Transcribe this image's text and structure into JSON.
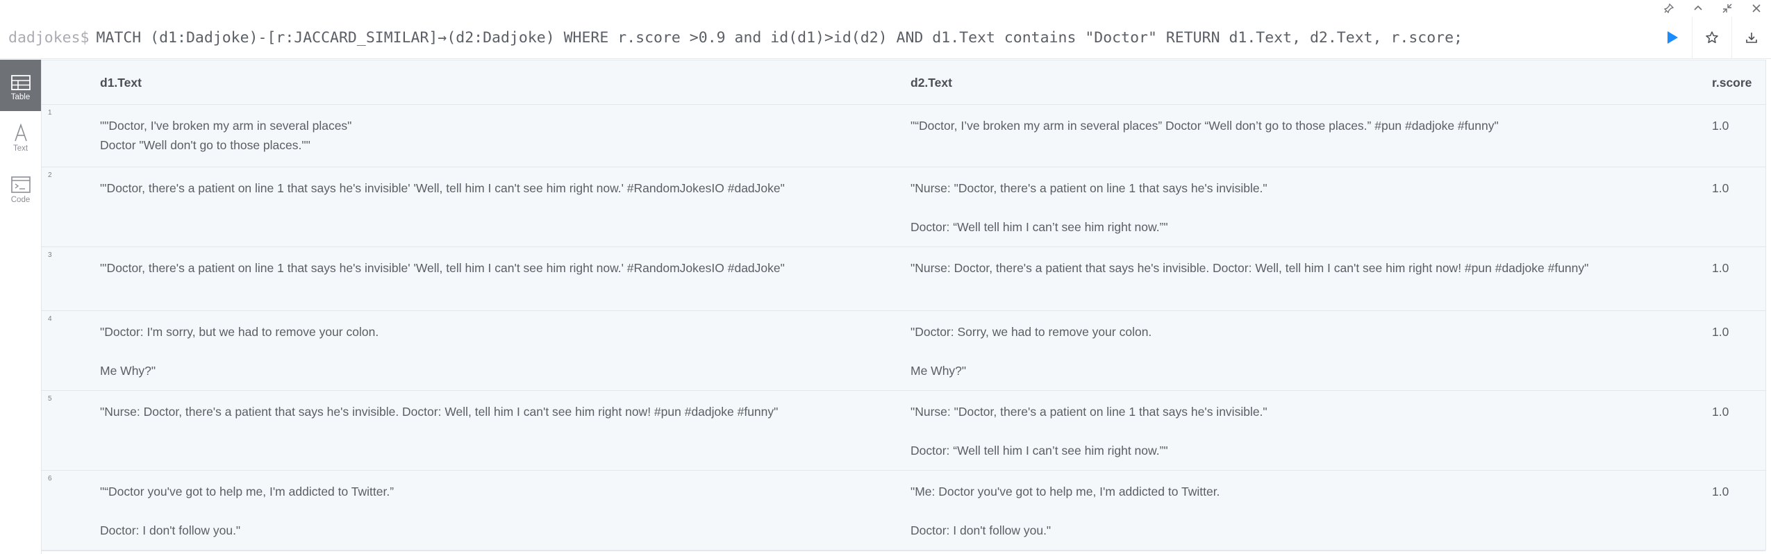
{
  "window_controls": [
    "pin-icon",
    "chevron-up-icon",
    "collapse-icon",
    "close-icon"
  ],
  "editor": {
    "prompt": "dadjokes$",
    "query": "MATCH (d1:Dadjoke)-[r:JACCARD_SIMILAR]→(d2:Dadjoke) WHERE r.score >0.9 and id(d1)>id(d2) AND d1.Text contains \"Doctor\" RETURN d1.Text, d2.Text, r.score;",
    "run_color": "#1a8cff"
  },
  "rail": [
    {
      "label": "Table",
      "icon": "table-icon",
      "active": true
    },
    {
      "label": "Text",
      "icon": "text-icon",
      "active": false
    },
    {
      "label": "Code",
      "icon": "code-icon",
      "active": false
    }
  ],
  "table": {
    "headers": [
      "d1.Text",
      "d2.Text",
      "r.score"
    ],
    "rows": [
      {
        "num": "1",
        "d1_line1": "\"\"Doctor, I've broken my arm in several places\"",
        "d1_line2": "Doctor \"Well don't go to those places.\"\"",
        "d2_line1": "\"“Doctor, I’ve broken my arm in several places” Doctor “Well don’t go to those places.” #pun #dadjoke #funny\"",
        "d2_line2": "",
        "score": "1.0"
      },
      {
        "num": "2",
        "d1_line1": "\"'Doctor, there's a patient on line 1 that says he's invisible' 'Well, tell him I can't see him right now.' #RandomJokesIO #dadJoke\"",
        "d1_line2": "",
        "d2_line1": "\"Nurse: \"Doctor, there's a patient on line 1 that says he's invisible.\"",
        "d2_line2": "Doctor: “Well tell him I can’t see him right now.”\"",
        "score": "1.0"
      },
      {
        "num": "3",
        "d1_line1": "\"'Doctor, there's a patient on line 1 that says he's invisible' 'Well, tell him I can't see him right now.' #RandomJokesIO #dadJoke\"",
        "d1_line2": "",
        "d2_line1": "\"Nurse: Doctor, there's a patient that says he's invisible. Doctor: Well, tell him I can't see him right now! #pun #dadjoke #funny\"",
        "d2_line2": "",
        "score": "1.0"
      },
      {
        "num": "4",
        "d1_line1": "\"Doctor: I'm sorry, but we had to remove your colon.",
        "d1_line2": "Me Why?\"",
        "d2_line1": "\"Doctor: Sorry, we had to remove your colon.",
        "d2_line2": "Me Why?\"",
        "score": "1.0"
      },
      {
        "num": "5",
        "d1_line1": "\"Nurse: Doctor, there's a patient that says he's invisible. Doctor: Well, tell him I can't see him right now! #pun #dadjoke #funny\"",
        "d1_line2": "",
        "d2_line1": "\"Nurse: \"Doctor, there's a patient on line 1 that says he's invisible.\"",
        "d2_line2": "Doctor: “Well tell him I can’t see him right now.”\"",
        "score": "1.0"
      },
      {
        "num": "6",
        "d1_line1": "\"“Doctor you've got to help me, I'm addicted to Twitter.”",
        "d1_line2": "Doctor: I don't follow you.\"",
        "d2_line1": "\"Me: Doctor you've got to help me, I'm addicted to Twitter.",
        "d2_line2": "Doctor: I don't follow you.\"",
        "score": "1.0"
      }
    ]
  }
}
